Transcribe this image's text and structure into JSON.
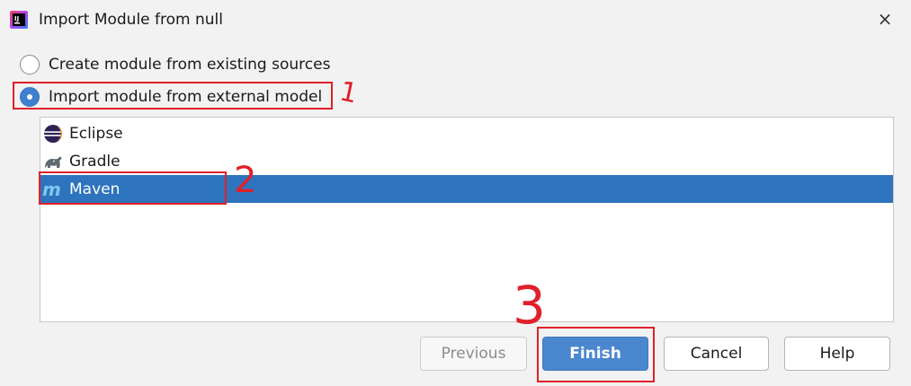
{
  "window": {
    "title": "Import Module from null",
    "close_icon": "×"
  },
  "options": [
    {
      "label": "Create module from existing sources",
      "checked": false
    },
    {
      "label": "Import module from external model",
      "checked": true
    }
  ],
  "models": [
    {
      "label": "Eclipse",
      "icon": "eclipse-icon",
      "selected": false
    },
    {
      "label": "Gradle",
      "icon": "gradle-icon",
      "selected": false
    },
    {
      "label": "Maven",
      "icon": "maven-icon",
      "selected": true
    }
  ],
  "buttons": {
    "previous": "Previous",
    "finish": "Finish",
    "cancel": "Cancel",
    "help": "Help"
  },
  "annotations": {
    "one": "1",
    "two": "2",
    "three": "3",
    "color": "#e0202a"
  },
  "colors": {
    "selection": "#2e73bd",
    "primary_button": "#4a87cf"
  }
}
